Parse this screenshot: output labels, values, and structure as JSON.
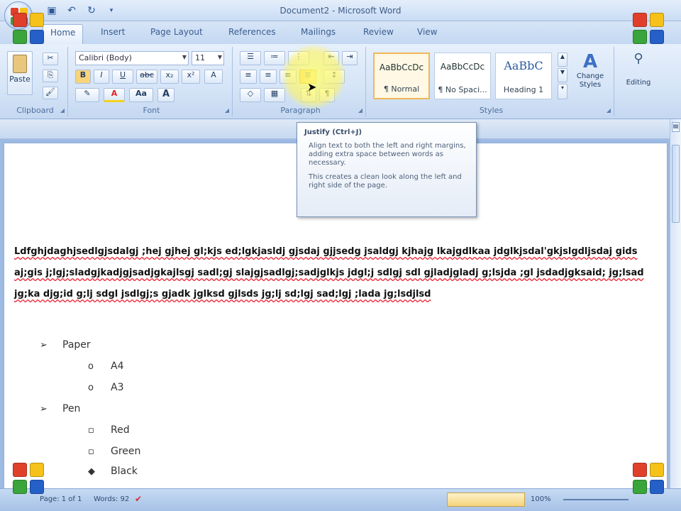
{
  "window": {
    "title": "Document2 - Microsoft Word"
  },
  "qat": {
    "save_icon": "save-icon",
    "undo_icon": "undo-icon",
    "redo_icon": "redo-icon",
    "customize_icon": "dropdown-icon"
  },
  "tabs": [
    "Home",
    "Insert",
    "Page Layout",
    "References",
    "Mailings",
    "Review",
    "View"
  ],
  "ribbon": {
    "clipboard": {
      "label": "Clipboard",
      "paste": "Paste"
    },
    "font": {
      "label": "Font",
      "font_name": "Calibri (Body)",
      "font_size": "11",
      "bold": "B",
      "italic": "I",
      "underline": "U",
      "strike": "abc",
      "subscript": "x₂",
      "superscript": "x²",
      "color": "A",
      "grow": "Aa",
      "shrink_a": "A",
      "clear": "A"
    },
    "paragraph": {
      "label": "Paragraph"
    },
    "styles": {
      "label": "Styles",
      "items": [
        {
          "sample": "AaBbCcDc",
          "name": "¶ Normal"
        },
        {
          "sample": "AaBbCcDc",
          "name": "¶ No Spaci..."
        },
        {
          "sample": "AaBbC",
          "name": "Heading 1"
        }
      ],
      "change_styles": "Change Styles"
    },
    "editing": {
      "label": "Editing"
    }
  },
  "tooltip": {
    "title": "Justify (Ctrl+J)",
    "line1": "Align text to both the left and right margins, adding extra space between words as necessary.",
    "line2": "This creates a clean look along the left and right side of the page."
  },
  "document": {
    "paragraph": "Ldfghjdaghjsedlgjsdalgj ;hej gjhej gl;kjs ed;lgkjasldj gjsdaj gjjsedg jsaldgj kjhajg lkajgdlkaa jdglkjsdal'gkjslgdljsdaj gids aj;gis j;lgj;sladgjkadjgjsadjgkajlsgj sadl;gj slajgjsadlgj;sadjglkjs jdgl;j sdlgj sdl gjladjgladj g;lsjda ;gl jsdadjgksaid; jg;lsad jg;ka djg;id g;lj sdgl jsdlgj;s gjadk jglksd gjlsds jg;lj sd;lgj sad;lgj ;lada jg;lsdjlsd",
    "list": [
      {
        "level": 1,
        "bullet": "➢",
        "text": "Paper"
      },
      {
        "level": 2,
        "bullet": "o",
        "text": "A4"
      },
      {
        "level": 2,
        "bullet": "o",
        "text": "A3"
      },
      {
        "level": 1,
        "bullet": "➢",
        "text": "Pen"
      },
      {
        "level": 2,
        "bullet": "▫",
        "text": "Red"
      },
      {
        "level": 2,
        "bullet": "▫",
        "text": "Green"
      },
      {
        "level": 2,
        "bullet": "◆",
        "text": "Black"
      }
    ]
  },
  "status": {
    "page": "Page: 1 of 1",
    "words": "Words: 92",
    "zoom": "100%"
  },
  "colors": {
    "accent": "#2d5a9c",
    "spell_underline": "#e22233",
    "highlight": "#fff25a"
  }
}
